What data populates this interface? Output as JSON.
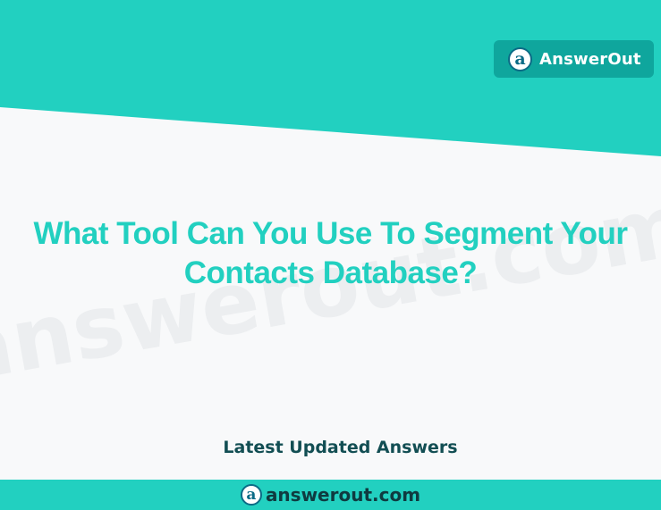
{
  "colors": {
    "teal": "#22d0c0",
    "badge_teal": "#0fa69d",
    "dark_text": "#124e53",
    "logo_blue": "#0b6b86",
    "background": "#f8f9fa"
  },
  "brand": {
    "logo_glyph": "a",
    "name": "AnswerOut"
  },
  "watermark": {
    "text": "answerout.com"
  },
  "content": {
    "title_line1": "What Tool Can You Use To Segment Your",
    "title_line2": "Contacts Database?",
    "subtitle": "Latest Updated Answers"
  },
  "footer": {
    "logo_glyph": "a",
    "domain": "answerout.com"
  }
}
